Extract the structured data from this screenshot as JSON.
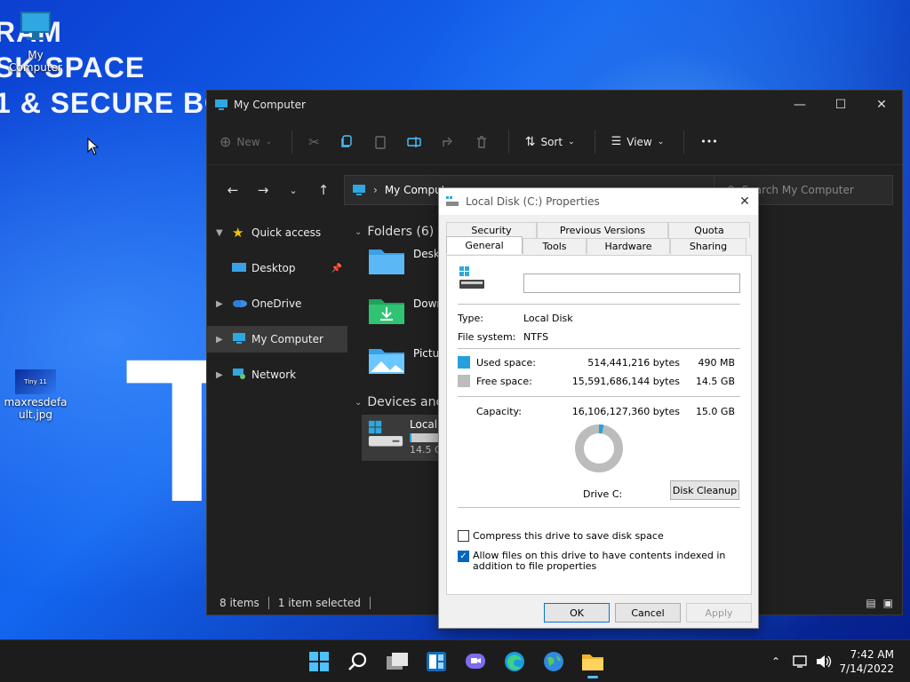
{
  "desktop": {
    "wallpaper_text": [
      "RAM",
      "SK SPACE",
      "1 & SECURE BO"
    ],
    "wallpaper_big": "T",
    "icons": [
      {
        "label": "My Computer"
      },
      {
        "label": "maxresdefault.jpg",
        "thumb_text": "Tiny 11"
      }
    ]
  },
  "explorer": {
    "title": "My Computer",
    "commands": {
      "new": "New",
      "sort": "Sort",
      "view": "View",
      "more": "•••"
    },
    "address": "My Computer",
    "search_placeholder": "Search My Computer",
    "nav": [
      {
        "label": "Quick access",
        "icon": "star-icon"
      },
      {
        "label": "Desktop",
        "icon": "desktop-folder-icon"
      },
      {
        "label": "OneDrive",
        "icon": "onedrive-cloud-icon"
      },
      {
        "label": "My Computer",
        "icon": "computer-icon",
        "selected": true
      },
      {
        "label": "Network",
        "icon": "network-icon"
      }
    ],
    "folders_header": "Folders (6)",
    "folders": [
      "Deskt",
      "Down",
      "Pictur"
    ],
    "devices_header": "Devices and",
    "device": {
      "name": "Local",
      "free": "14.5 G",
      "used_fraction": 0.032
    },
    "status": {
      "items": "8 items",
      "selected": "1 item selected"
    }
  },
  "dialog": {
    "title": "Local Disk (C:) Properties",
    "tabs_back": [
      "Security",
      "Previous Versions",
      "Quota"
    ],
    "tabs_front": [
      "General",
      "Tools",
      "Hardware",
      "Sharing"
    ],
    "active_tab": "General",
    "name_value": "",
    "type_label": "Type:",
    "type_value": "Local Disk",
    "fs_label": "File system:",
    "fs_value": "NTFS",
    "used_label": "Used space:",
    "used_bytes": "514,441,216 bytes",
    "used_human": "490 MB",
    "used_color": "#26a0da",
    "free_label": "Free space:",
    "free_bytes": "15,591,686,144 bytes",
    "free_human": "14.5 GB",
    "free_color": "#bcbcbc",
    "capacity_label": "Capacity:",
    "capacity_bytes": "16,106,127,360 bytes",
    "capacity_human": "15.0 GB",
    "used_fraction": 0.032,
    "drive_label": "Drive C:",
    "cleanup": "Disk Cleanup",
    "compress": {
      "label": "Compress this drive to save disk space",
      "checked": false
    },
    "index": {
      "label": "Allow files on this drive to have contents indexed in addition to file properties",
      "checked": true
    },
    "ok": "OK",
    "cancel": "Cancel",
    "apply": "Apply"
  },
  "taskbar": {
    "apps": [
      "start-icon",
      "search-icon",
      "task-view-icon",
      "widgets-icon",
      "chat-icon",
      "edge-icon",
      "browser-globe-icon",
      "file-explorer-icon"
    ],
    "time": "7:42 AM",
    "date": "7/14/2022"
  }
}
